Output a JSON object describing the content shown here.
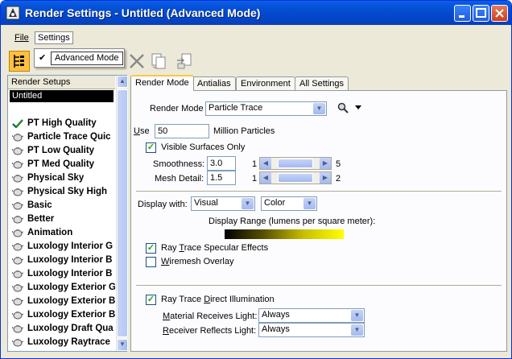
{
  "window": {
    "title": "Render Settings - Untitled (Advanced Mode)"
  },
  "menubar": {
    "file": "File",
    "settings": "Settings"
  },
  "settings_menu": {
    "advanced_mode": "Advanced Mode",
    "checked": true
  },
  "left_panel": {
    "header": "Render Setups",
    "selected": "Untitled",
    "items": [
      {
        "label": "PT High Quality",
        "icon": "check-icon"
      },
      {
        "label": "Particle Trace Quic",
        "icon": "teapot-icon"
      },
      {
        "label": "PT Low Quality",
        "icon": "teapot-icon"
      },
      {
        "label": "PT Med Quality",
        "icon": "teapot-icon"
      },
      {
        "label": "Physical Sky",
        "icon": "teapot-icon"
      },
      {
        "label": "Physical Sky High",
        "icon": "teapot-icon"
      },
      {
        "label": "Basic",
        "icon": "teapot-icon"
      },
      {
        "label": "Better",
        "icon": "teapot-icon"
      },
      {
        "label": "Animation",
        "icon": "teapot-icon"
      },
      {
        "label": "Luxology Interior G",
        "icon": "teapot-icon"
      },
      {
        "label": "Luxology Interior B",
        "icon": "teapot-icon"
      },
      {
        "label": "Luxology Interior B",
        "icon": "teapot-icon"
      },
      {
        "label": "Luxology Exterior G",
        "icon": "teapot-icon"
      },
      {
        "label": "Luxology Exterior B",
        "icon": "teapot-icon"
      },
      {
        "label": "Luxology Exterior B",
        "icon": "teapot-icon"
      },
      {
        "label": "Luxology Draft Qua",
        "icon": "teapot-icon"
      },
      {
        "label": "Luxology Raytrace",
        "icon": "teapot-icon"
      }
    ]
  },
  "tabs": [
    "Render Mode",
    "Antialias",
    "Environment",
    "All Settings"
  ],
  "render_mode": {
    "label": "Render Mode",
    "value": "Particle Trace",
    "use_prefix": "U",
    "use_rest": "se",
    "use_value": "50",
    "use_suffix": "Million Particles",
    "visible_surfaces": "Visible Surfaces Only",
    "smoothness_label": "Smoothness:",
    "smoothness_value": "3.0",
    "smoothness_min": "1",
    "smoothness_max": "5",
    "smoothness_level": 0.5,
    "mesh_label": "Mesh Detail:",
    "mesh_value": "1.5",
    "mesh_min": "1",
    "mesh_max": "2",
    "mesh_level": 0.5
  },
  "display": {
    "label": "Display with:",
    "mode": "Visual",
    "color": "Color",
    "range_label": "Display Range (lumens per square meter):"
  },
  "effects": {
    "specular_pre": "Ray ",
    "specular_u": "T",
    "specular_post": "race Specular Effects",
    "wiremesh_u": "W",
    "wiremesh_post": "iremesh Overlay",
    "specular_checked": true,
    "wiremesh_checked": false
  },
  "illumination": {
    "direct_pre": "Ray Trace ",
    "direct_u": "D",
    "direct_post": "irect Illumination",
    "material_u": "M",
    "material_post": "aterial Receives Light:",
    "material_value": "Always",
    "receiver_u": "R",
    "receiver_post": "eceiver Reflects Light:",
    "receiver_value": "Always"
  }
}
